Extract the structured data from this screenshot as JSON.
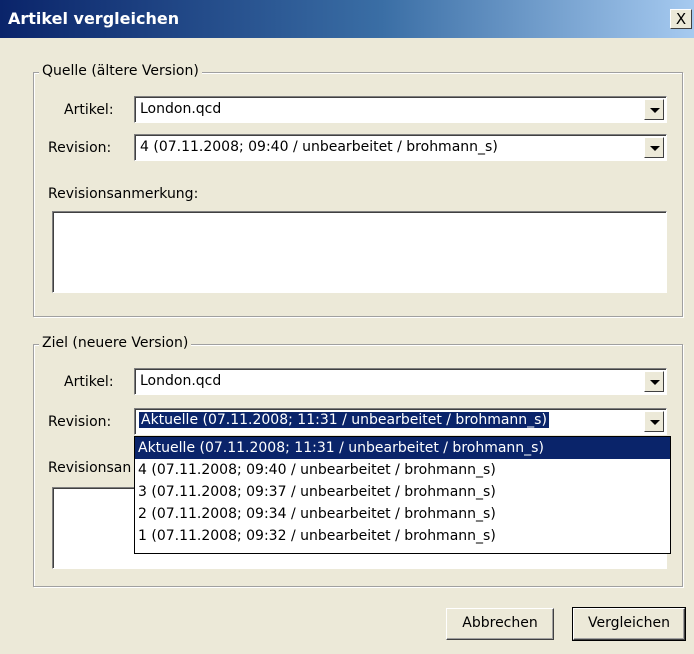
{
  "window": {
    "title": "Artikel vergleichen",
    "close_glyph": "X"
  },
  "source": {
    "legend": "Quelle (ältere Version)",
    "article_label": "Artikel:",
    "article_value": "London.qcd",
    "revision_label": "Revision:",
    "revision_value": "4 (07.11.2008; 09:40 / unbearbeitet / brohmann_s)",
    "note_label": "Revisionsanmerkung:",
    "note_value": ""
  },
  "target": {
    "legend": "Ziel (neuere Version)",
    "article_label": "Artikel:",
    "article_value": "London.qcd",
    "revision_label": "Revision:",
    "revision_value": "Aktuelle (07.11.2008; 11:31 / unbearbeitet / brohmann_s)",
    "note_label": "Revisionsan",
    "note_value": "",
    "revision_options": [
      "Aktuelle (07.11.2008; 11:31 / unbearbeitet / brohmann_s)",
      "4 (07.11.2008; 09:40 / unbearbeitet / brohmann_s)",
      "3 (07.11.2008; 09:37 / unbearbeitet / brohmann_s)",
      "2 (07.11.2008; 09:34 / unbearbeitet / brohmann_s)",
      "1 (07.11.2008; 09:32 / unbearbeitet / brohmann_s)"
    ]
  },
  "buttons": {
    "cancel": "Abbrechen",
    "compare": "Vergleichen"
  },
  "colors": {
    "title_bar": "#0a246a",
    "selection": "#0a246a",
    "face": "#ece9d8"
  }
}
